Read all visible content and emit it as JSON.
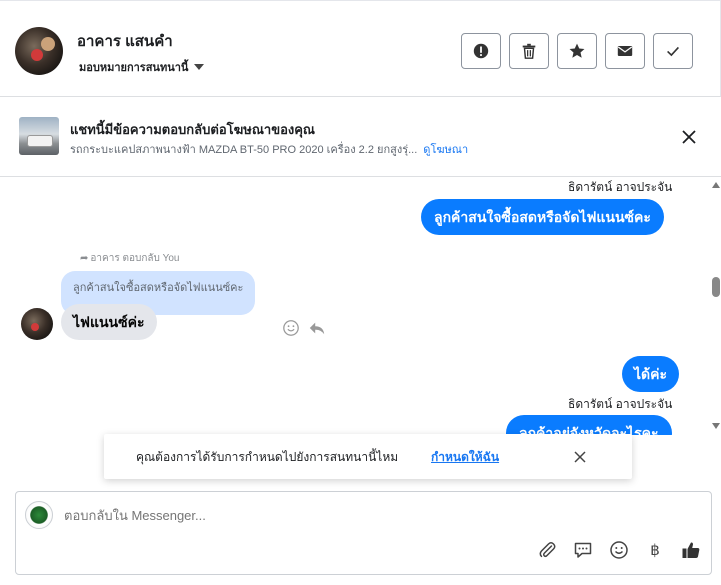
{
  "header": {
    "contact_name": "อาคาร แสนคำ",
    "assign_label": "มอบหมายการสนทนานี้"
  },
  "actions": [
    {
      "icon": "alert-icon",
      "name": "mark-spam-button"
    },
    {
      "icon": "trash-icon",
      "name": "delete-button"
    },
    {
      "icon": "star-icon",
      "name": "star-button"
    },
    {
      "icon": "envelope-icon",
      "name": "mark-unread-button"
    },
    {
      "icon": "check-icon",
      "name": "mark-done-button"
    }
  ],
  "ad": {
    "title": "แชทนี้มีข้อความตอบกลับต่อโฆษณาของคุณ",
    "subtitle": "รถกระบะแคปสภาพนางฟ้า MAZDA BT-50 PRO 2020 เครื่อง 2.2 ยกสูงรุ่...",
    "link": "ดูโฆษณา"
  },
  "messages": {
    "sender_top": "ธิดารัตน์ อาจประจัน",
    "out_1": "ลูกค้าสนใจซื้อสดหรือจัดไฟแนนซ์คะ",
    "reply_note": "อาคาร ตอบกลับ You",
    "quoted": "ลูกค้าสนใจซื้อสดหรือจัดไฟแนนซ์คะ",
    "in_1": "ไฟแนนซ์ค่ะ",
    "out_2": "ได้ค่ะ",
    "sender_bottom": "ธิดารัตน์ อาจประจัน",
    "out_3": "ลูกค้าอยู่จังหวัดอะไรคะ"
  },
  "toast": {
    "text": "คุณต้องการได้รับการกำหนดไปยังการสนทนานี้ไหม",
    "link": "กำหนดให้ฉัน"
  },
  "composer": {
    "placeholder": "ตอบกลับใน Messenger...",
    "currency_symbol": "฿"
  },
  "colors": {
    "accent": "#0a7cff",
    "link": "#1877f2",
    "quote_bg": "#d1e3ff",
    "incoming_bg": "#e4e6eb"
  }
}
